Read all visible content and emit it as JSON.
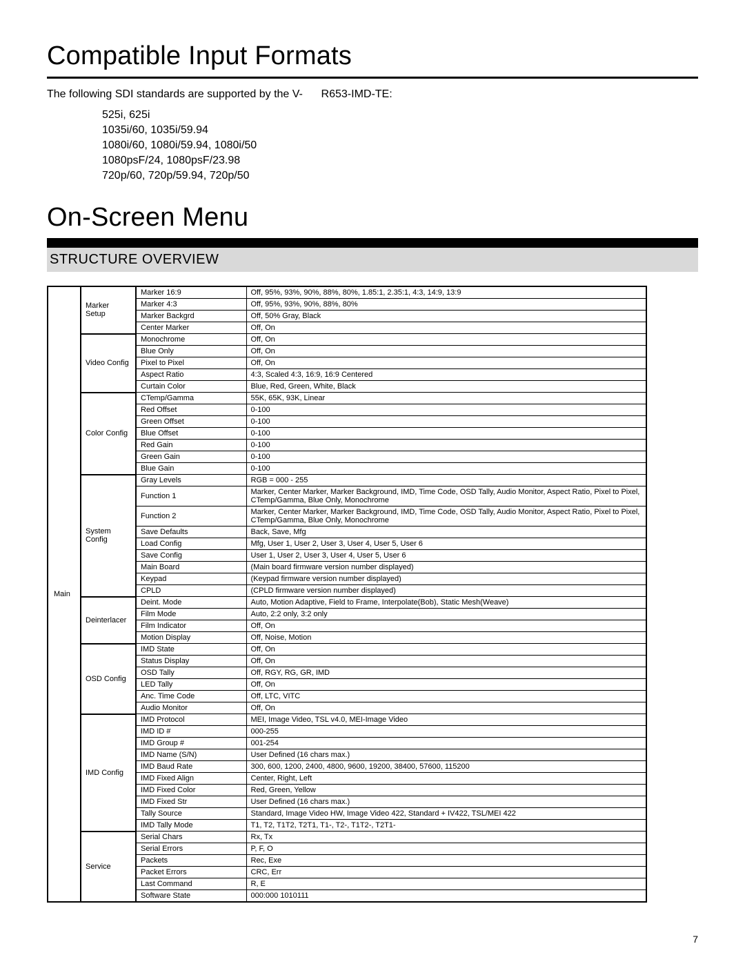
{
  "page_number": "7",
  "section1": {
    "title": "Compatible Input Formats",
    "intro_pre": "The following SDI standards are supported by the V-",
    "intro_post": "R653-IMD-TE:",
    "formats": [
      "525i, 625i",
      "1035i/60, 1035i/59.94",
      "1080i/60, 1080i/59.94, 1080i/50",
      "1080psF/24, 1080psF/23.98",
      "720p/60, 720p/59.94, 720p/50"
    ]
  },
  "section2": {
    "title": "On-Screen Menu",
    "subtitle": "STRUCTURE OVERVIEW",
    "root": "Main",
    "groups": [
      {
        "name": "Marker Setup",
        "rows": [
          {
            "k": "Marker 16:9",
            "v": "Off, 95%, 93%, 90%, 88%, 80%, 1.85:1, 2.35:1, 4:3, 14:9, 13:9"
          },
          {
            "k": "Marker 4:3",
            "v": "Off, 95%, 93%, 90%, 88%, 80%"
          },
          {
            "k": "Marker Backgrd",
            "v": "Off, 50% Gray, Black"
          },
          {
            "k": "Center Marker",
            "v": "Off, On"
          }
        ]
      },
      {
        "name": "Video Config",
        "rows": [
          {
            "k": "Monochrome",
            "v": "Off, On"
          },
          {
            "k": "Blue Only",
            "v": "Off, On"
          },
          {
            "k": "Pixel to Pixel",
            "v": "Off, On"
          },
          {
            "k": "Aspect Ratio",
            "v": "4:3, Scaled 4:3, 16:9, 16:9 Centered"
          },
          {
            "k": "Curtain Color",
            "v": "Blue, Red, Green, White, Black"
          }
        ]
      },
      {
        "name": "Color Config",
        "rows": [
          {
            "k": "CTemp/Gamma",
            "v": "55K, 65K, 93K, Linear"
          },
          {
            "k": "Red Offset",
            "v": "0-100"
          },
          {
            "k": "Green Offset",
            "v": "0-100"
          },
          {
            "k": "Blue Offset",
            "v": "0-100"
          },
          {
            "k": "Red Gain",
            "v": "0-100"
          },
          {
            "k": "Green Gain",
            "v": "0-100"
          },
          {
            "k": "Blue Gain",
            "v": "0-100"
          }
        ]
      },
      {
        "name": "System Config",
        "rows": [
          {
            "k": "Gray Levels",
            "v": "RGB = 000 - 255"
          },
          {
            "k": "Function 1",
            "v": "Marker, Center Marker, Marker Background, IMD, Time Code, OSD Tally, Audio Monitor, Aspect Ratio, Pixel to Pixel, CTemp/Gamma, Blue Only, Monochrome"
          },
          {
            "k": "Function 2",
            "v": "Marker, Center Marker, Marker Background, IMD, Time Code, OSD Tally, Audio Monitor, Aspect Ratio, Pixel to Pixel, CTemp/Gamma, Blue Only, Monochrome"
          },
          {
            "k": "Save Defaults",
            "v": "Back, Save, Mfg"
          },
          {
            "k": "Load Config",
            "v": "Mfg, User 1, User 2, User 3, User 4, User 5, User 6"
          },
          {
            "k": "Save Config",
            "v": "User 1, User 2, User 3, User 4, User 5, User 6"
          },
          {
            "k": "Main Board",
            "v": "(Main board firmware version number displayed)"
          },
          {
            "k": "Keypad",
            "v": "(Keypad firmware version number displayed)"
          },
          {
            "k": "CPLD",
            "v": "(CPLD firmware version number displayed)"
          }
        ]
      },
      {
        "name": "Deinterlacer",
        "rows": [
          {
            "k": "Deint. Mode",
            "v": "Auto, Motion Adaptive, Field to Frame, Interpolate(Bob), Static Mesh(Weave)"
          },
          {
            "k": "Film Mode",
            "v": "Auto, 2:2 only, 3:2 only"
          },
          {
            "k": "Film Indicator",
            "v": "Off, On"
          },
          {
            "k": "Motion Display",
            "v": "Off, Noise, Motion"
          }
        ]
      },
      {
        "name": "OSD Config",
        "rows": [
          {
            "k": "IMD State",
            "v": "Off, On"
          },
          {
            "k": "Status Display",
            "v": "Off, On"
          },
          {
            "k": "OSD Tally",
            "v": "Off, RGY, RG, GR, IMD"
          },
          {
            "k": "LED Tally",
            "v": "Off, On"
          },
          {
            "k": "Anc. Time Code",
            "v": "Off, LTC, VITC"
          },
          {
            "k": "Audio Monitor",
            "v": "Off, On"
          }
        ]
      },
      {
        "name": "IMD Config",
        "rows": [
          {
            "k": "IMD Protocol",
            "v": "MEI, Image Video, TSL v4.0, MEI-Image Video"
          },
          {
            "k": "IMD ID #",
            "v": "000-255"
          },
          {
            "k": "IMD Group #",
            "v": "001-254"
          },
          {
            "k": "IMD Name (S/N)",
            "v": "User Defined (16 chars max.)"
          },
          {
            "k": "IMD Baud Rate",
            "v": "300, 600, 1200, 2400, 4800, 9600, 19200, 38400, 57600, 115200"
          },
          {
            "k": "IMD Fixed Align",
            "v": "Center, Right, Left"
          },
          {
            "k": "IMD Fixed Color",
            "v": "Red, Green, Yellow"
          },
          {
            "k": "IMD Fixed Str",
            "v": "User Defined (16 chars max.)"
          },
          {
            "k": "Tally Source",
            "v": "Standard, Image Video HW, Image Video 422, Standard + IV422, TSL/MEI 422"
          },
          {
            "k": "IMD Tally Mode",
            "v": "T1, T2, T1T2, T2T1, T1-, T2-, T1T2-, T2T1-"
          }
        ]
      },
      {
        "name": "Service",
        "rows": [
          {
            "k": "Serial Chars",
            "v": "Rx, Tx"
          },
          {
            "k": "Serial Errors",
            "v": "P, F, O"
          },
          {
            "k": "Packets",
            "v": "Rec, Exe"
          },
          {
            "k": "Packet Errors",
            "v": "CRC, Err"
          },
          {
            "k": "Last Command",
            "v": "R, E"
          },
          {
            "k": "Software State",
            "v": "000:000 1010111"
          }
        ]
      }
    ]
  }
}
